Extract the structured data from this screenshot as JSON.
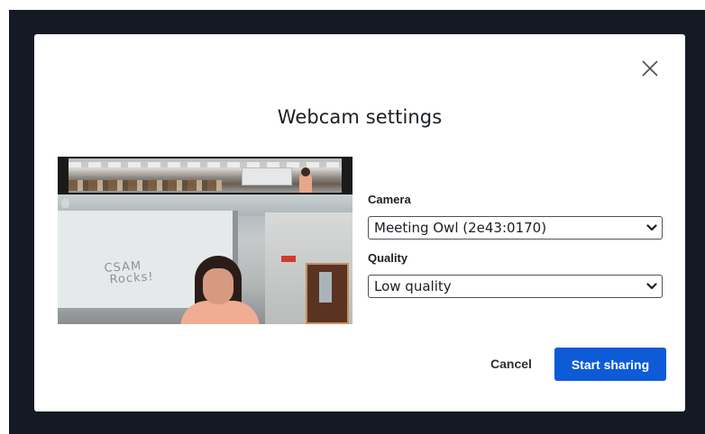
{
  "dialog": {
    "title": "Webcam settings",
    "close_icon": "close-icon"
  },
  "preview": {
    "whiteboard_text": "CSAM\nRocks!"
  },
  "form": {
    "camera_label": "Camera",
    "camera_value": "Meeting Owl (2e43:0170)",
    "quality_label": "Quality",
    "quality_value": "Low quality",
    "dropdown_icon": "chevron-down-icon"
  },
  "actions": {
    "cancel_label": "Cancel",
    "start_label": "Start sharing"
  },
  "colors": {
    "primary": "#0d5bd6",
    "backdrop": "#141a23"
  }
}
